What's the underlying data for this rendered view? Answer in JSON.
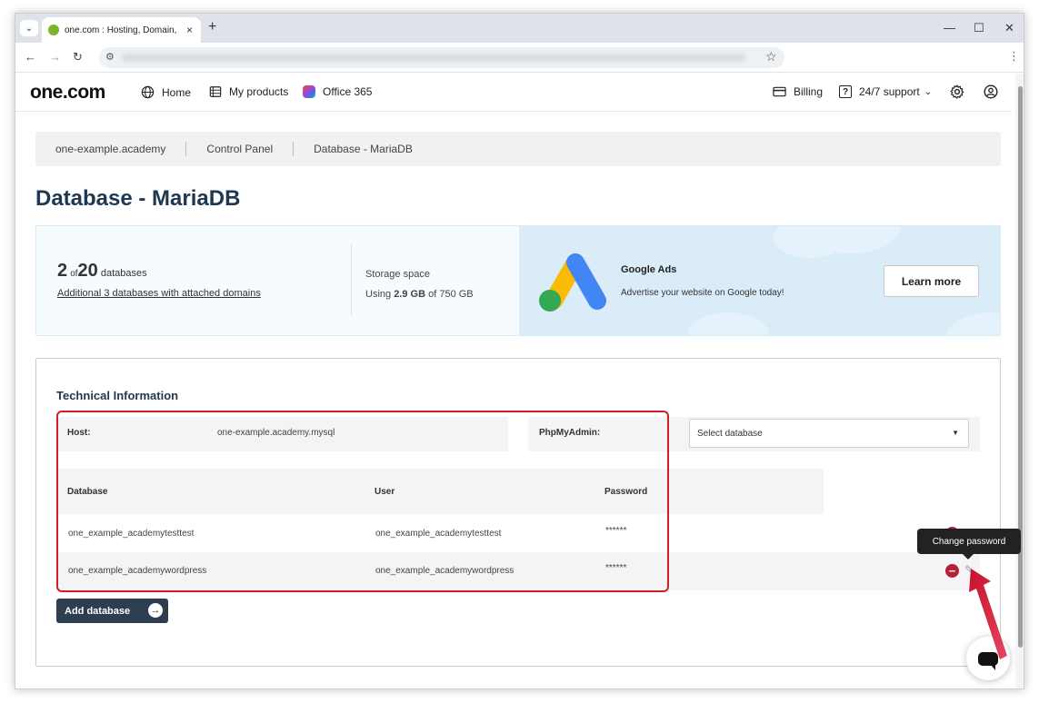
{
  "browser": {
    "tab_title": "one.com : Hosting, Domain, Email",
    "tab_close": "×",
    "new_tab": "+",
    "window_minimize": "—",
    "window_maximize": "☐",
    "window_close": "✕"
  },
  "header": {
    "logo": "one.com",
    "nav": [
      "Home",
      "My products",
      "Office 365"
    ],
    "billing": "Billing",
    "support": "24/7 support"
  },
  "breadcrumb": [
    "one-example.academy",
    "Control Panel",
    "Database - MariaDB"
  ],
  "page_title": "Database - MariaDB",
  "summary": {
    "db_used": "2",
    "of": "of",
    "db_total": "20",
    "db_unit": "databases",
    "db_link": "Additional 3 databases with attached domains",
    "storage_label": "Storage space",
    "storage_prefix": "Using",
    "storage_used": "2.9 GB",
    "storage_suffix": "of 750 GB"
  },
  "ad": {
    "title": "Google Ads",
    "subtitle": "Advertise your website on Google today!",
    "button": "Learn more"
  },
  "tech": {
    "title": "Technical Information",
    "host_label": "Host:",
    "host_value": "one-example.academy.mysql",
    "pma_label": "PhpMyAdmin:",
    "select_placeholder": "Select database",
    "columns": [
      "Database",
      "User",
      "Password"
    ],
    "rows": [
      {
        "database": "one_example_academytesttest",
        "user": "one_example_academytesttest",
        "password": "******"
      },
      {
        "database": "one_example_academywordpress",
        "user": "one_example_academywordpress",
        "password": "******"
      }
    ],
    "add_button": "Add database",
    "tooltip": "Change password"
  },
  "colors": {
    "accent_dark": "#2d3e50",
    "title_blue": "#1d3850",
    "delete_red": "#b5213a",
    "highlight_red": "#d21c2d"
  }
}
